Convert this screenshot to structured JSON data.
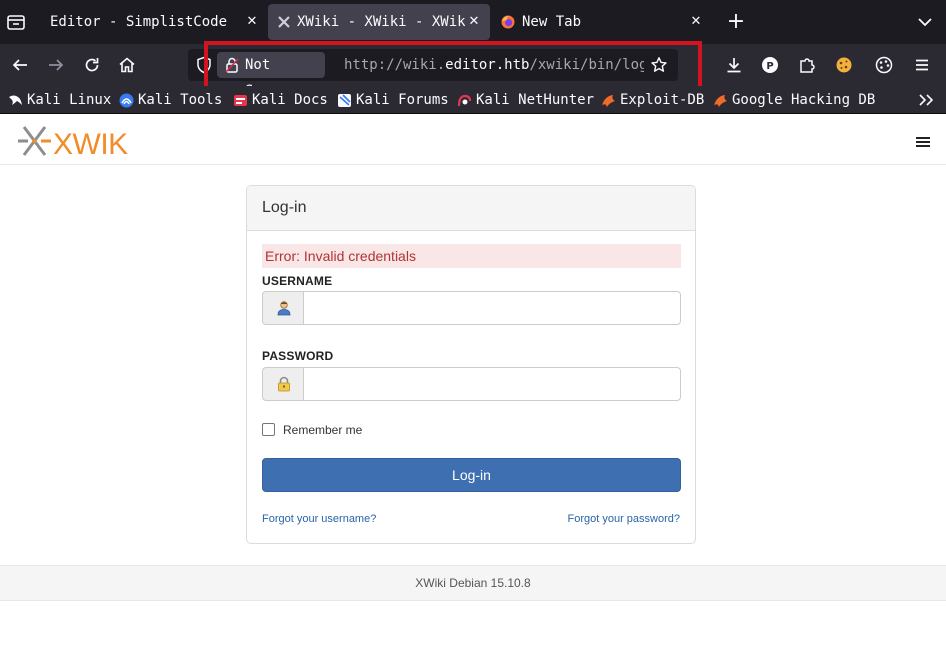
{
  "browser": {
    "tabs": [
      {
        "title": "Editor - SimplistCode Pro",
        "active": false
      },
      {
        "title": "XWiki - XWiki - XWiki",
        "active": true
      },
      {
        "title": "New Tab",
        "active": false
      }
    ],
    "tab_close_glyph": "✕",
    "new_tab_glyph": "+",
    "urlbar": {
      "security_label": "Not Secure",
      "url_prefix": "http://wiki.",
      "url_host": "editor.htb",
      "url_path": "/xwiki/bin/login/XWiki/XWikiLogin"
    },
    "highlight_color": "#d3131f",
    "bookmarks": [
      {
        "label": "Kali Linux",
        "icon": "kali-dragon-icon"
      },
      {
        "label": "Kali Tools",
        "icon": "kali-tools-icon"
      },
      {
        "label": "Kali Docs",
        "icon": "kali-docs-icon"
      },
      {
        "label": "Kali Forums",
        "icon": "kali-forums-icon"
      },
      {
        "label": "Kali NetHunter",
        "icon": "nethunter-icon"
      },
      {
        "label": "Exploit-DB",
        "icon": "exploit-db-icon"
      },
      {
        "label": "Google Hacking DB",
        "icon": "ghdb-icon"
      }
    ]
  },
  "page": {
    "logo_text": "XWIKI",
    "login": {
      "panel_title": "Log-in",
      "error": "Error: Invalid credentials",
      "username_label": "USERNAME",
      "username_value": "",
      "password_label": "PASSWORD",
      "password_value": "",
      "remember_label": "Remember me",
      "remember_checked": false,
      "submit_label": "Log-in",
      "forgot_username": "Forgot your username?",
      "forgot_password": "Forgot your password?"
    },
    "footer": "XWiki Debian 15.10.8"
  },
  "colors": {
    "chrome_dark": "#1c1b22",
    "chrome_toolbar": "#2b2a33",
    "primary_button": "#3e6fb0",
    "error_text": "#b23434",
    "error_bg": "#f9e6e6",
    "link": "#2a63a8",
    "xwiki_orange": "#f28c28"
  }
}
